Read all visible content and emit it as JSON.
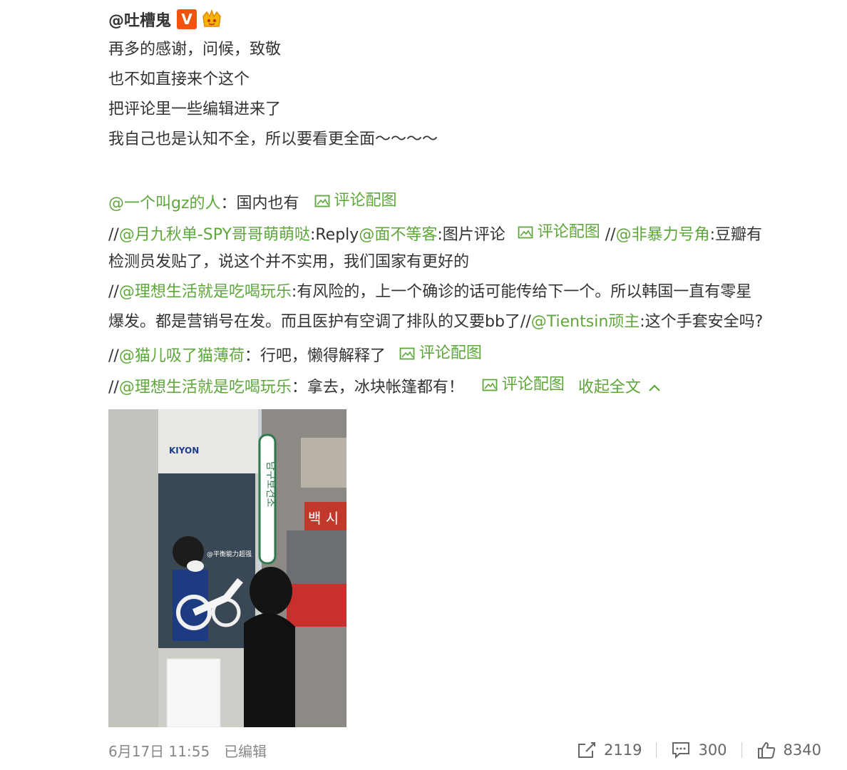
{
  "post": {
    "author": "@吐槽鬼",
    "verified_badge": "V",
    "body_lines": [
      "再多的感谢，问候，致敬",
      "也不如直接来个这个",
      "把评论里一些编辑进来了",
      "我自己也是认知不全，所以要看更全面～～～～"
    ],
    "reposts": {
      "l1": {
        "user": "@一个叫gz的人",
        "sep": "：",
        "text": "国内也有",
        "img": "评论配图"
      },
      "l2": {
        "p1": "//",
        "u1": "@月九秋单-SPY哥哥萌萌哒",
        "t1": ":Reply",
        "u2": "@面不等客",
        "t2": ":图片评论",
        "img": "评论配图",
        "p2": " //",
        "u3": "@非暴力号角",
        "t3": ":豆瓣有"
      },
      "l3": {
        "text": "检测员发贴了，说这个并不实用，我们国家有更好的"
      },
      "l4": {
        "p1": "//",
        "u1": "@理想生活就是吃喝玩乐",
        "t1": ":有风险的，上一个确诊的话可能传给下一个。所以韩国一直有零星"
      },
      "l5": {
        "t1": "爆发。都是营销号在发。而且医护有空调了排队的又要bb了//",
        "u1": "@Tientsin顽主",
        "t2": ":这个手套安全吗?"
      },
      "l6": {
        "p1": "//",
        "u1": "@猫儿吸了猫薄荷",
        "t1": "：行吧，懒得解释了",
        "img": "评论配图"
      },
      "l7": {
        "p1": "//",
        "u1": "@理想生活就是吃喝玩乐",
        "t1": "：拿去，冰块帐篷都有！",
        "img": "评论配图",
        "collapse": "收起全文"
      }
    },
    "photo": {
      "booth_brand": "KIYON",
      "sign_text": "남구보건소",
      "shop_sign": "백 시",
      "watermark": "@平衡能力超强"
    },
    "footer": {
      "date": "6月17日 11:55",
      "edited": "已编辑",
      "reposts_count": "2119",
      "comments_count": "300",
      "likes_count": "8340"
    }
  },
  "colors": {
    "link": "#5ea73a",
    "text": "#333333",
    "meta": "#888888",
    "badge": "#f2530f"
  }
}
